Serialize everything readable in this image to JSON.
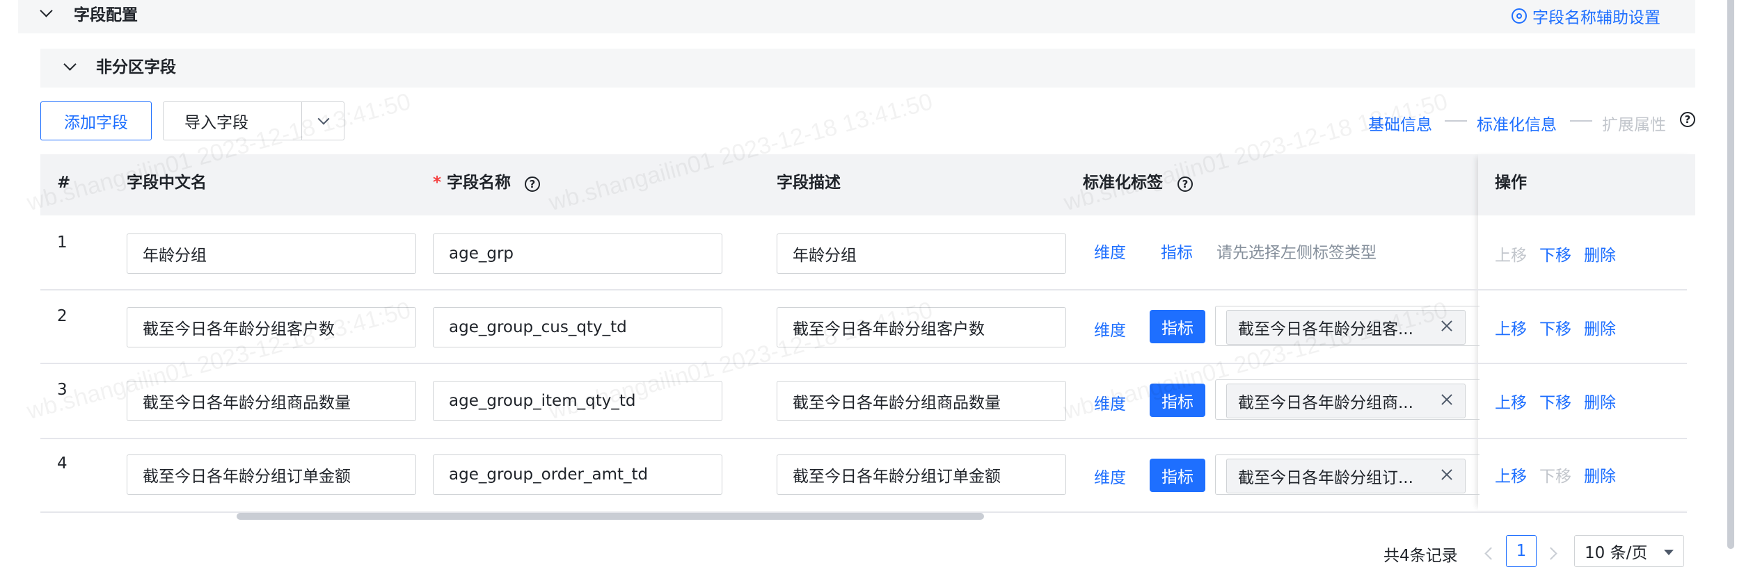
{
  "field_config": {
    "title": "字段配置",
    "assist_link": "字段名称辅助设置"
  },
  "non_partition": {
    "title": "非分区字段"
  },
  "toolbar": {
    "add_field": "添加字段",
    "import_field": "导入字段"
  },
  "steps": {
    "basic": "基础信息",
    "standard": "标准化信息",
    "extended": "扩展属性"
  },
  "table": {
    "headers": {
      "index": "#",
      "cn_name": "字段中文名",
      "required_mark": "*",
      "field_name": "字段名称",
      "desc": "字段描述",
      "tags": "标准化标签",
      "actions": "操作"
    },
    "rows": [
      {
        "index": "1",
        "cn_name": "年龄分组",
        "field_name": "age_grp",
        "desc": "年龄分组",
        "dim": "维度",
        "metric": "指标",
        "metric_active": false,
        "tag_text": "请先选择左侧标签类型",
        "up": "上移",
        "down": "下移",
        "delete": "删除",
        "up_enabled": false,
        "down_enabled": true
      },
      {
        "index": "2",
        "cn_name": "截至今日各年龄分组客户数",
        "field_name": "age_group_cus_qty_td",
        "desc": "截至今日各年龄分组客户数",
        "dim": "维度",
        "metric": "指标",
        "metric_active": true,
        "tag_text": "截至今日各年龄分组客...",
        "up": "上移",
        "down": "下移",
        "delete": "删除",
        "up_enabled": true,
        "down_enabled": true
      },
      {
        "index": "3",
        "cn_name": "截至今日各年龄分组商品数量",
        "field_name": "age_group_item_qty_td",
        "desc": "截至今日各年龄分组商品数量",
        "dim": "维度",
        "metric": "指标",
        "metric_active": true,
        "tag_text": "截至今日各年龄分组商...",
        "up": "上移",
        "down": "下移",
        "delete": "删除",
        "up_enabled": true,
        "down_enabled": true
      },
      {
        "index": "4",
        "cn_name": "截至今日各年龄分组订单金额",
        "field_name": "age_group_order_amt_td",
        "desc": "截至今日各年龄分组订单金额",
        "dim": "维度",
        "metric": "指标",
        "metric_active": true,
        "tag_text": "截至今日各年龄分组订...",
        "up": "上移",
        "down": "下移",
        "delete": "删除",
        "up_enabled": true,
        "down_enabled": false
      }
    ]
  },
  "pagination": {
    "total": "共4条记录",
    "current": "1",
    "page_size": "10 条/页"
  },
  "watermark": "wb.shangailin01 2023-12-18 13:41:50",
  "colors": {
    "primary": "#1e6fff",
    "header_bg": "#f2f3f5",
    "disabled": "#c2c6cc"
  }
}
